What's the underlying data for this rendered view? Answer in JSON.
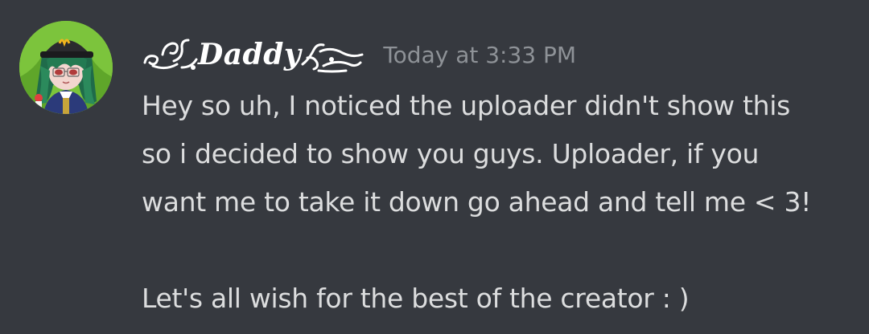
{
  "message": {
    "author": {
      "display_name": "Daddy",
      "avatar_icon": "anime-avatar-icon"
    },
    "timestamp": "Today at 3:33 PM",
    "content_lines": [
      "Hey so uh, I noticed the uploader didn't show this",
      "so i decided to show you guys. Uploader, if you",
      "want me to take it down go ahead and tell me < 3!",
      "",
      "Let's all wish for the best of the creator : )"
    ]
  },
  "colors": {
    "background": "#36393f",
    "username": "#ffffff",
    "timestamp": "#8e9297",
    "text": "#dcddde",
    "avatar_bg": "#7cc43c"
  }
}
